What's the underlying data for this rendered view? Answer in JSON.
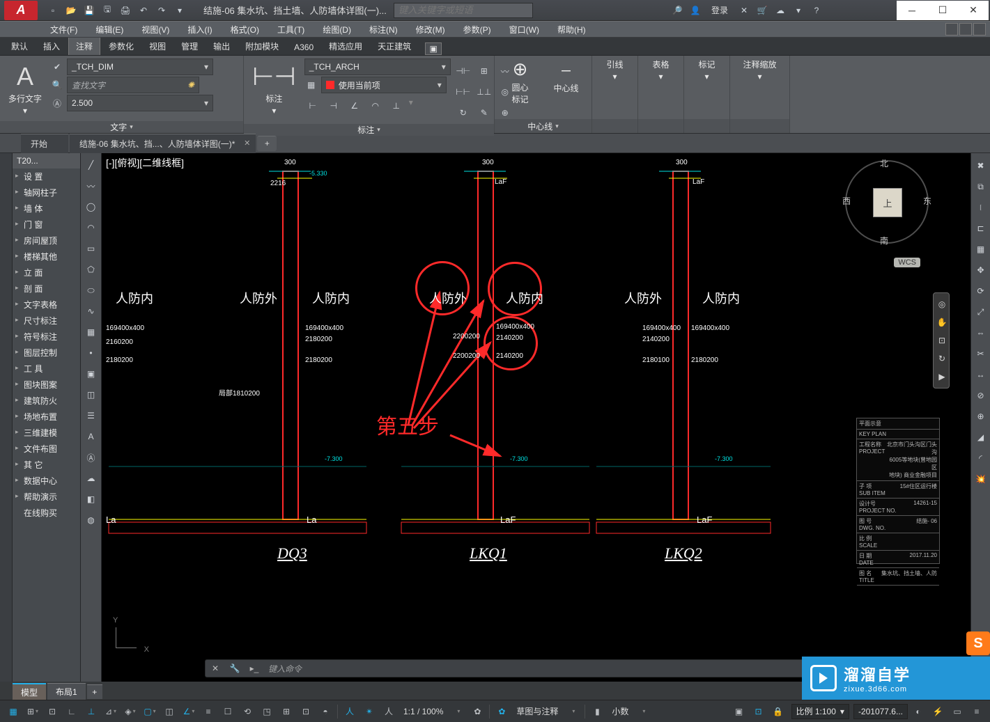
{
  "title": "结施-06 集水坑、挡土墙、人防墙体详图(一)...",
  "search_placeholder": "键入关键字或短语",
  "login": "登录",
  "menubar": [
    "文件(F)",
    "编辑(E)",
    "视图(V)",
    "插入(I)",
    "格式(O)",
    "工具(T)",
    "绘图(D)",
    "标注(N)",
    "修改(M)",
    "参数(P)",
    "窗口(W)",
    "帮助(H)"
  ],
  "ribbon_tabs": [
    "默认",
    "插入",
    "注释",
    "参数化",
    "视图",
    "管理",
    "输出",
    "附加模块",
    "A360",
    "精选应用",
    "天正建筑"
  ],
  "ribbon_active_tab": "注释",
  "panel_text": {
    "multitext": "多行文字",
    "dim_style": "_TCH_DIM",
    "find_placeholder": "查找文字",
    "height": "2.500",
    "text_panel": "文字",
    "arch_style": "_TCH_ARCH",
    "layer_opt": "使用当前项",
    "dim_label": "标注",
    "dim_panel": "标注",
    "circle_mark": "圆心\n标记",
    "centerline": "中心线",
    "center_panel": "中心线",
    "leader": "引线",
    "table": "表格",
    "mark": "标记",
    "annoscale": "注释缩放"
  },
  "doctabs": {
    "start": "开始",
    "doc": "结施-06 集水坑、挡...、人防墙体详图(一)*"
  },
  "side_title": "T20...",
  "side_items": [
    "设    置",
    "轴网柱子",
    "墙    体",
    "门    窗",
    "房间屋顶",
    "楼梯其他",
    "立    面",
    "剖    面",
    "文字表格",
    "尺寸标注",
    "符号标注",
    "图层控制",
    "工    具",
    "图块图案",
    "建筑防火",
    "场地布置",
    "三维建模",
    "文件布图",
    "其    它",
    "数据中心",
    "帮助演示",
    "在线购买"
  ],
  "viewport_label": "[-][俯视][二维线框]",
  "cube": {
    "face": "上",
    "n": "北",
    "s": "南",
    "e": "东",
    "w": "西"
  },
  "wcs": "WCS",
  "labels": {
    "inside": "人防内",
    "outside": "人防外"
  },
  "sections": [
    "DQ3",
    "LKQ1",
    "LKQ2"
  ],
  "bottom_marks": [
    "La",
    "La",
    "LaF",
    "LaF"
  ],
  "annotation": "第五步",
  "tb": {
    "plan": "平面示意",
    "plan_en": "KEY PLAN",
    "proj_lbl": "工程名称\nPROJECT",
    "proj_val": "北京市门头沟区门头沟\n6005等地块(曾地园区\n地块) 商业金融项目",
    "sub_lbl": "子 项\nSUB ITEM",
    "sub_val": "15#住区运行楼",
    "design_lbl": "设计号\nPROJECT NO.",
    "design_val": "14261-15",
    "dwg_lbl": "图 号\nDWG. NO.",
    "dwg_val": "结施- 06",
    "scale_lbl": "比 例\nSCALE",
    "date_lbl": "日 期\nDATE",
    "date_val": "2017.11.20",
    "name_lbl": "图 名\nTITLE",
    "name_val": "集水坑、挡土墙、人防"
  },
  "cmd_placeholder": "键入命令",
  "layouts": {
    "model": "模型",
    "layout1": "布局1"
  },
  "status": {
    "zoom": "1:1 / 100%",
    "drawnote": "草图与注释",
    "decimal": "小数",
    "scale": "比例 1:100",
    "coord": "-201077.6..."
  },
  "overlay": {
    "big": "溜溜自学",
    "small": "zixue.3d66.com"
  },
  "small_dims": {
    "tl1": "300",
    "tl2": "2216",
    "tl3": "-5.330",
    "s1a": "169400x400",
    "s1b": "2160200",
    "s1c": "2180200",
    "mid1": "169400x400",
    "mid2": "2180200",
    "mid3": "2180200",
    "r1": "169400x400",
    "r2": "2200200",
    "r3": "2200200",
    "rr1": "169400x400",
    "rr2": "2140200",
    "rr3": "2140200",
    "far1": "169400x400",
    "far2": "2140200",
    "far3": "2180100",
    "far_r1": "169400x400",
    "far_r2": "2180200",
    "laf": "LaF",
    "elev": "-7.300",
    "bh": "局部1810200"
  }
}
